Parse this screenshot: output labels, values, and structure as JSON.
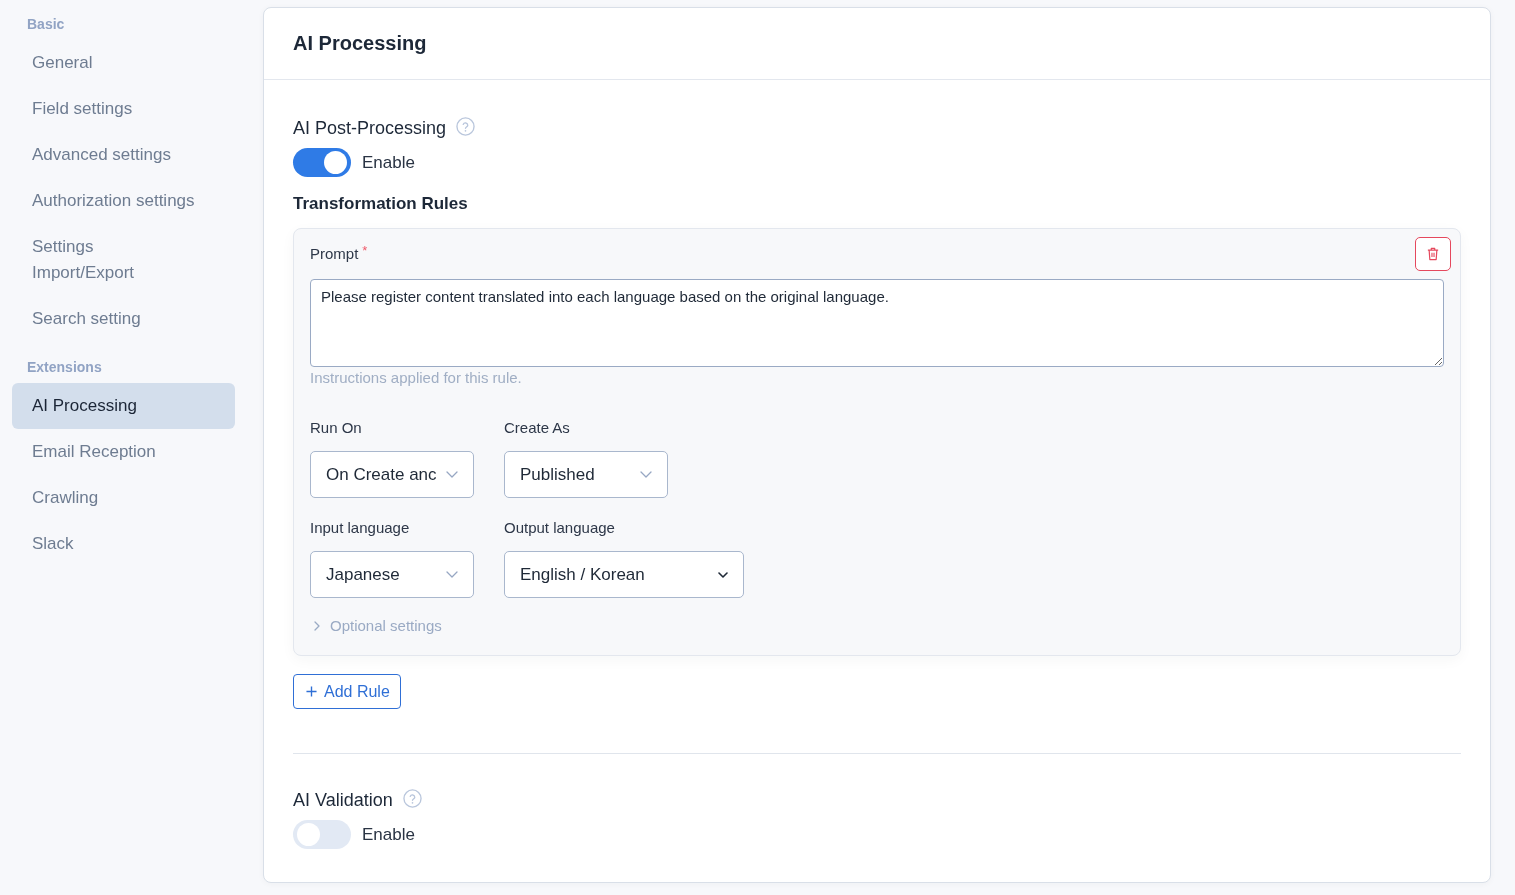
{
  "sidebar": {
    "sections": [
      {
        "heading": "Basic",
        "items": [
          {
            "label": "General",
            "selected": false
          },
          {
            "label": "Field settings",
            "selected": false
          },
          {
            "label": "Advanced settings",
            "selected": false
          },
          {
            "label": "Authorization settings",
            "selected": false
          },
          {
            "label": "Settings Import/Export",
            "selected": false
          },
          {
            "label": "Search setting",
            "selected": false
          }
        ]
      },
      {
        "heading": "Extensions",
        "items": [
          {
            "label": "AI Processing",
            "selected": true
          },
          {
            "label": "Email Reception",
            "selected": false
          },
          {
            "label": "Crawling",
            "selected": false
          },
          {
            "label": "Slack",
            "selected": false
          }
        ]
      }
    ]
  },
  "panel": {
    "title": "AI Processing"
  },
  "post_processing": {
    "title": "AI Post-Processing",
    "toggle": {
      "label": "Enable",
      "on": true
    },
    "rules_title": "Transformation Rules",
    "rules": [
      {
        "prompt": {
          "label": "Prompt",
          "required_mark": "*",
          "value": "Please register content translated into each language based on the original language.",
          "hint": "Instructions applied for this rule."
        },
        "fields": [
          {
            "label": "Run On",
            "value": "On Create anc",
            "kind": "select"
          },
          {
            "label": "Create As",
            "value": "Published",
            "kind": "select"
          },
          {
            "label": "Input language",
            "value": "Japanese",
            "kind": "select"
          },
          {
            "label": "Output language",
            "value": "English / Korean",
            "kind": "native-select"
          }
        ],
        "optional_settings": {
          "label": "Optional settings",
          "expanded": false
        }
      }
    ],
    "add_button": {
      "label": "Add Rule"
    }
  },
  "validation": {
    "title": "AI Validation",
    "toggle": {
      "label": "Enable",
      "on": false
    }
  }
}
